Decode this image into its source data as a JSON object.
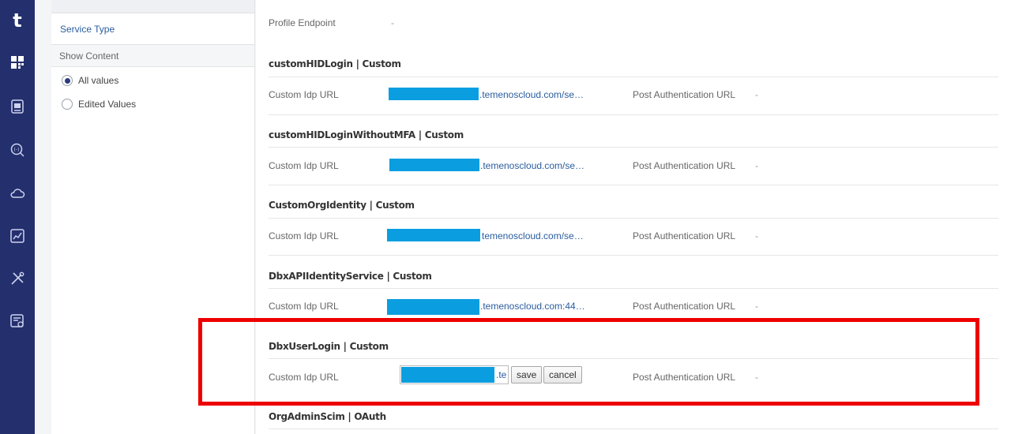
{
  "app": {
    "logo_letter": "t"
  },
  "nav_rail": {
    "icons": [
      "dashboard-icon",
      "api-icon",
      "search-code-icon",
      "cloud-icon",
      "analytics-icon",
      "tools-icon",
      "settings-panel-icon"
    ]
  },
  "filter_panel": {
    "service_type_label": "Service Type",
    "show_content_label": "Show Content",
    "options": [
      {
        "label": "All values",
        "checked": true
      },
      {
        "label": "Edited Values",
        "checked": false
      }
    ]
  },
  "main": {
    "profile_endpoint_label": "Profile Endpoint",
    "profile_endpoint_value": "-",
    "sections": [
      {
        "title": "customHIDLogin | Custom",
        "idp_label": "Custom Idp URL",
        "idp_url_suffix": ".temenoscloud.com/se…",
        "post_auth_label": "Post Authentication URL",
        "post_auth_value": "-"
      },
      {
        "title": "customHIDLoginWithoutMFA | Custom",
        "idp_label": "Custom Idp URL",
        "idp_url_suffix": ".temenoscloud.com/se…",
        "post_auth_label": "Post Authentication URL",
        "post_auth_value": "-"
      },
      {
        "title": "CustomOrgIdentity | Custom",
        "idp_label": "Custom Idp URL",
        "idp_url_suffix": "temenoscloud.com/se…",
        "post_auth_label": "Post Authentication URL",
        "post_auth_value": "-"
      },
      {
        "title": "DbxAPIIdentityService | Custom",
        "idp_label": "Custom Idp URL",
        "idp_url_suffix": ".temenoscloud.com:44…",
        "post_auth_label": "Post Authentication URL",
        "post_auth_value": "-"
      },
      {
        "title": "DbxUserLogin | Custom",
        "idp_label": "Custom Idp URL",
        "idp_edit_tail": ".te",
        "save_label": "save",
        "cancel_label": "cancel",
        "post_auth_label": "Post Authentication URL",
        "post_auth_value": "-"
      },
      {
        "title": "OrgAdminScim | OAuth"
      }
    ]
  },
  "colors": {
    "rail": "#242f6e",
    "link": "#2a5d9f",
    "redaction": "#0a9ee0",
    "highlight": "#ee0000"
  }
}
